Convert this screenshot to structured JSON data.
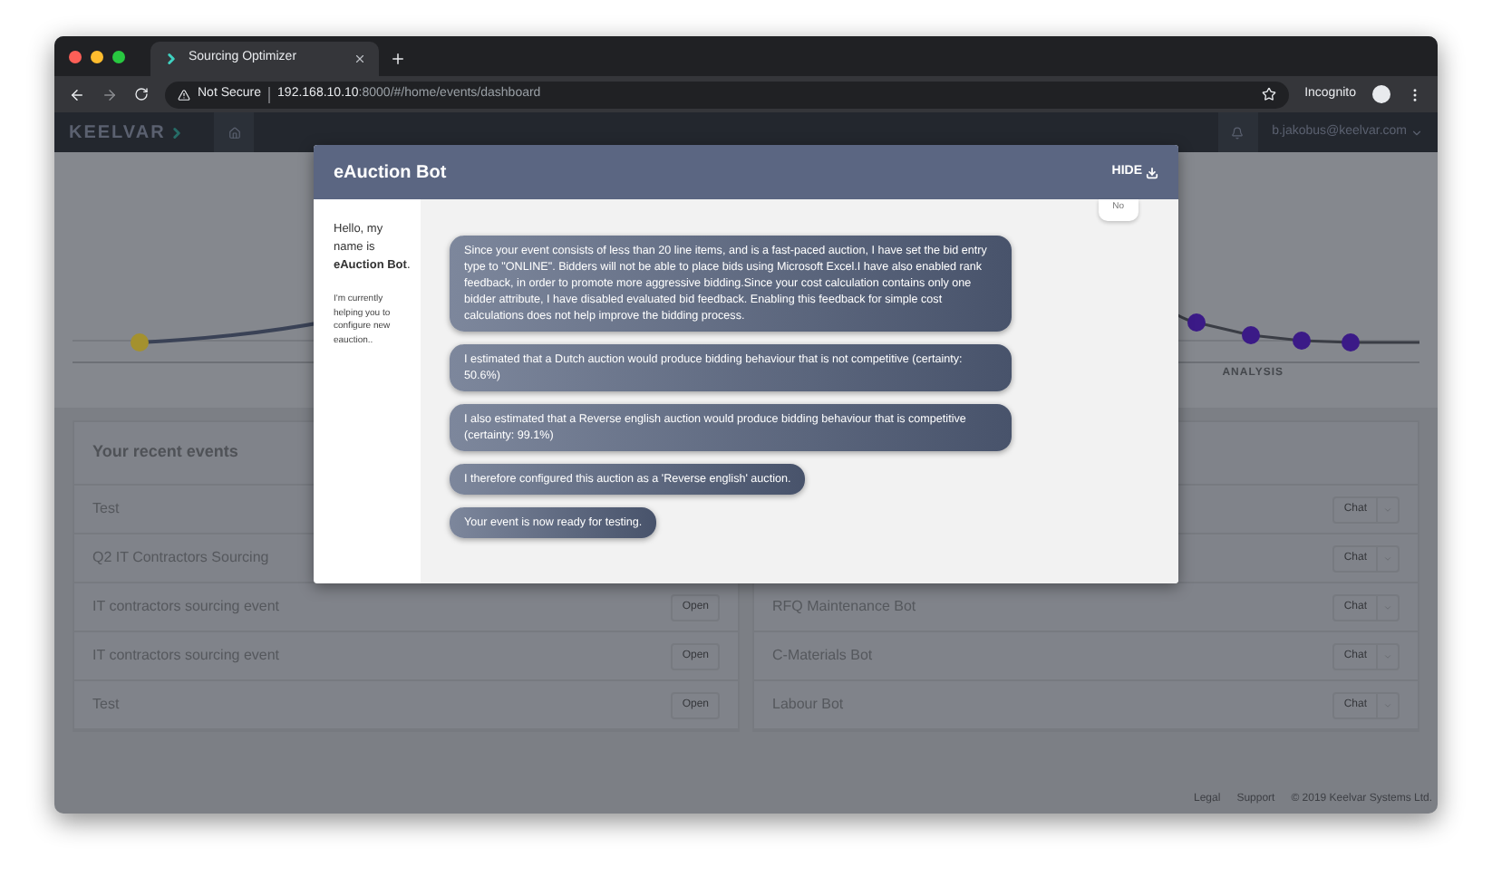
{
  "browser": {
    "tab_title": "Sourcing Optimizer",
    "security": "Not Secure",
    "url_host": "192.168.10.10",
    "url_rest": ":8000/#/home/events/dashboard",
    "profile": "Incognito"
  },
  "app_header": {
    "logo": "KEELVAR",
    "user": "b.jakobus@keelvar.com"
  },
  "timeline": {
    "label": "ANALYSIS"
  },
  "recent_events": {
    "title": "Your recent events",
    "rows": [
      {
        "name": "Test"
      },
      {
        "name": "Q2 IT Contractors Sourcing"
      },
      {
        "name": "IT contractors sourcing event",
        "action": "Open"
      },
      {
        "name": "IT contractors sourcing event",
        "action": "Open"
      },
      {
        "name": "Test",
        "action": "Open"
      }
    ]
  },
  "bots": {
    "rows": [
      {
        "action": "Chat"
      },
      {
        "action": "Chat"
      },
      {
        "name": "RFQ Maintenance Bot",
        "action": "Chat"
      },
      {
        "name": "C-Materials Bot",
        "action": "Chat"
      },
      {
        "name": "Labour Bot",
        "action": "Chat"
      }
    ]
  },
  "footer": [
    "Legal",
    "Support",
    "© 2019 Keelvar Systems Ltd."
  ],
  "modal": {
    "title": "eAuction Bot",
    "hide": "HIDE",
    "intro": "Hello, my name is **eAuction Bot**.",
    "status": "I'm currently helping you to configure new eauction..",
    "user_reply": "No",
    "messages": [
      "Since your event consists of less than 20 line items, and is a fast-paced auction, I have set the bid entry type to \"ONLINE\". Bidders will not be able to place bids using Microsoft Excel.I have also enabled rank feedback, in order to promote more aggressive bidding.Since your cost calculation contains only one bidder attribute, I have disabled evaluated bid feedback. Enabling this feedback for simple cost calculations does not help improve the bidding process.",
      "I estimated that a Dutch auction would produce bidding behaviour that is not competitive (certainty: 50.6%)",
      "I also estimated that a Reverse english auction would produce bidding behaviour that is competitive (certainty: 99.1%)",
      "I therefore configured this auction as a 'Reverse english' auction.",
      "Your event is now ready for testing."
    ]
  }
}
